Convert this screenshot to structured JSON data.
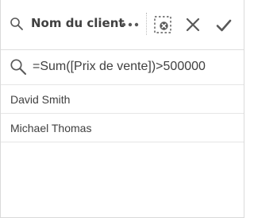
{
  "header": {
    "title": "Nom du client",
    "icons": {
      "search": "search-icon",
      "more": "more-options-icon",
      "clear_selection": "clear-selection-icon",
      "cancel": "close-icon",
      "confirm": "checkmark-icon"
    }
  },
  "search": {
    "value": "=Sum([Prix de vente])>500000",
    "icon": "search-icon"
  },
  "list": {
    "items": [
      {
        "label": "David Smith"
      },
      {
        "label": "Michael Thomas"
      }
    ]
  },
  "colors": {
    "text": "#404040",
    "icon": "#595959",
    "border": "#dedede"
  }
}
